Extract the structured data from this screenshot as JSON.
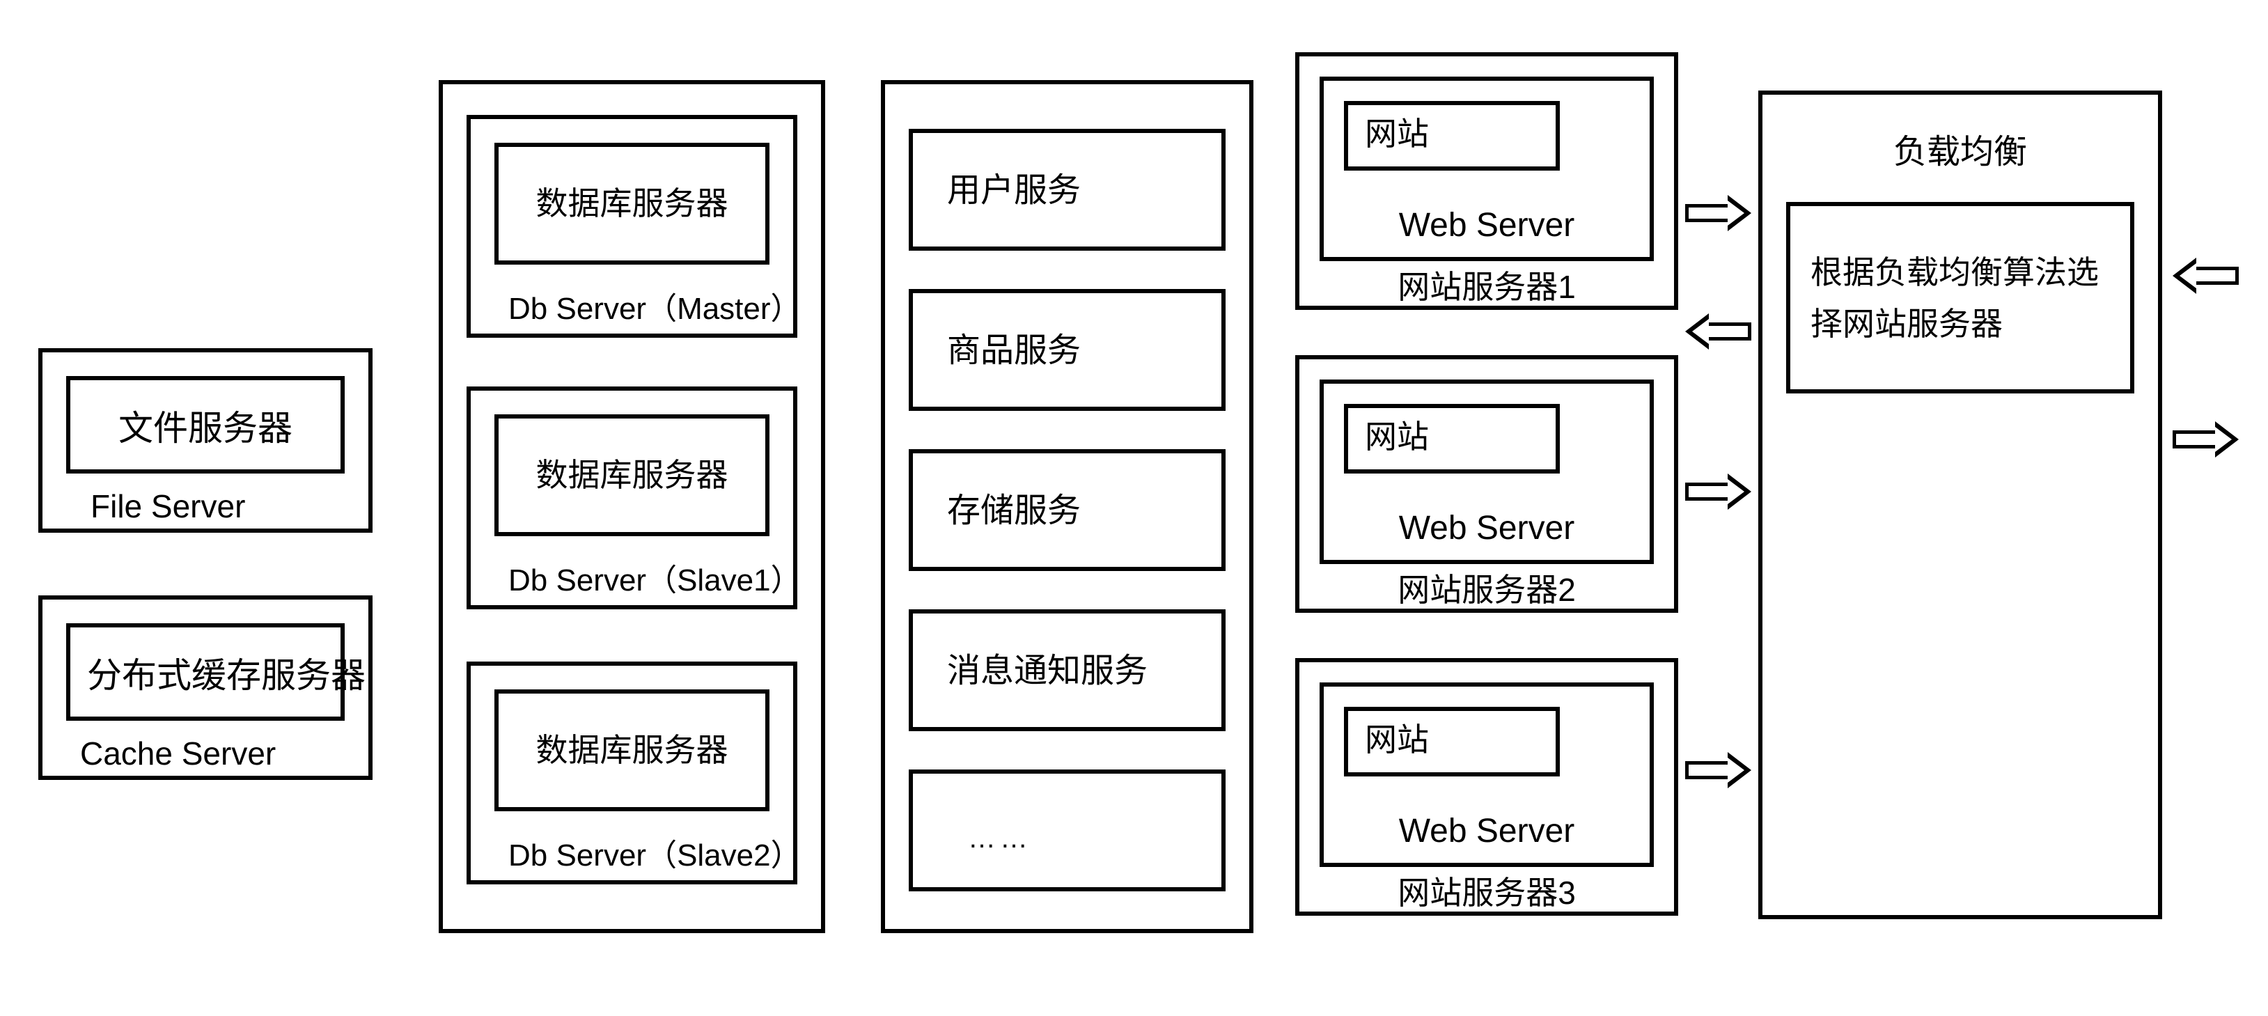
{
  "col1": {
    "file_server": {
      "zh": "文件服务器",
      "en": "File Server"
    },
    "cache_server": {
      "zh": "分布式缓存服务器",
      "en": "Cache Server"
    }
  },
  "col2": {
    "db_inner_zh": "数据库服务器",
    "db_master_label": "Db  Server（Master）",
    "db_slave1_label": "Db  Server（Slave1）",
    "db_slave2_label": "Db  Server（Slave2）"
  },
  "col3": {
    "svc1": "用户服务",
    "svc2": "商品服务",
    "svc3": "存储服务",
    "svc4": "消息通知服务",
    "svc5": "……"
  },
  "col4": {
    "web_inner_zh": "网站",
    "web_en": "Web Server",
    "web1_label": "网站服务器1",
    "web2_label": "网站服务器2",
    "web3_label": "网站服务器3"
  },
  "col5": {
    "lb_title": "负载均衡",
    "lb_desc": "根据负载均衡算法选择网站服务器"
  }
}
